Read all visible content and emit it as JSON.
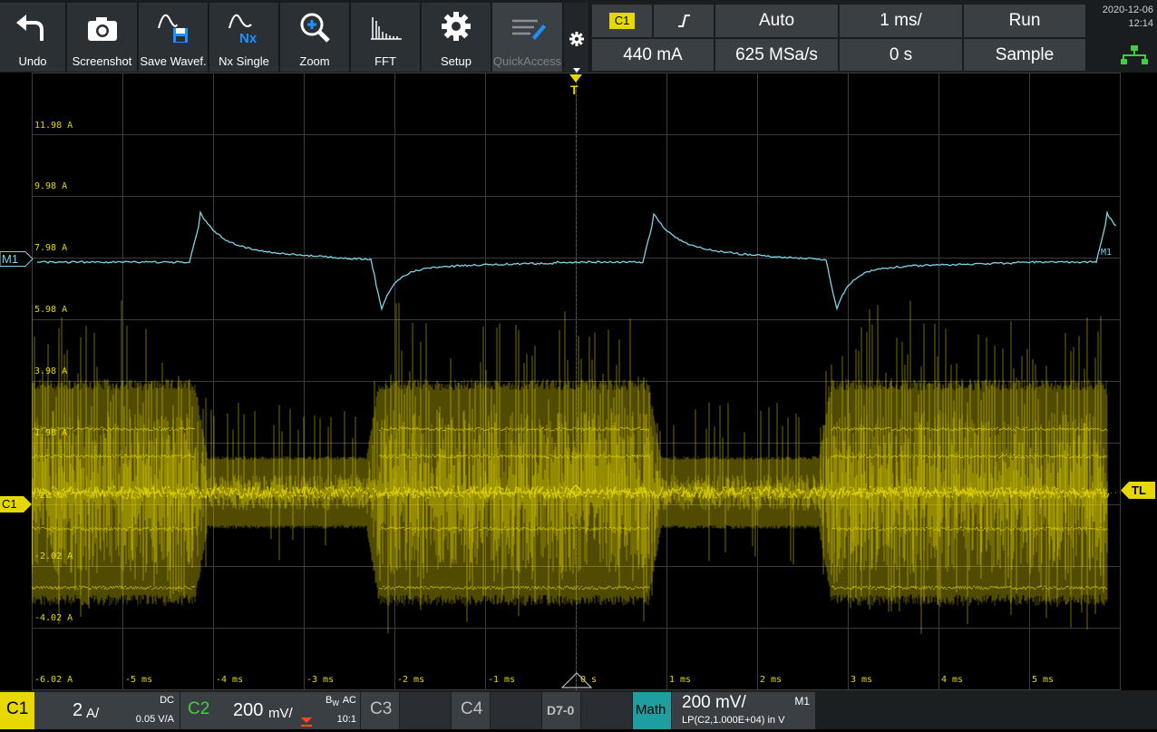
{
  "toolbar": {
    "undo_label": "Undo",
    "screenshot_label": "Screenshot",
    "save_waveform_label": "Save Wavef.",
    "nx_single_label": "Nx Single",
    "nx_icon_text": "Nx",
    "zoom_label": "Zoom",
    "fft_label": "FFT",
    "setup_label": "Setup",
    "quickaccess_label": "QuickAccess"
  },
  "status": {
    "trigger_source": "C1",
    "trigger_mode": "Auto",
    "time_scale": "1 ms/",
    "run_state": "Run",
    "trigger_level": "440 mA",
    "sample_rate": "625 MSa/s",
    "time_offset": "0 s",
    "acquisition_mode": "Sample",
    "date": "2020-12-06",
    "time": "12:14"
  },
  "scope": {
    "m1_marker": "M1",
    "m1_trace_label": "M1",
    "c1_marker": "C1",
    "trigger_marker": "T",
    "trigger_level_marker": "TL",
    "y_labels": [
      "11.98 A",
      "9.98 A",
      "7.98 A",
      "5.98 A",
      "3.98 A",
      "1.98 A",
      "-20 mA",
      "-2.02 A",
      "-4.02 A",
      "-6.02 A"
    ],
    "x_labels": [
      "-5 ms",
      "-4 ms",
      "-3 ms",
      "-2 ms",
      "-1 ms",
      "0 s",
      "1 ms",
      "2 ms",
      "3 ms",
      "4 ms",
      "5 ms"
    ],
    "colors": {
      "c1": "#e6d800",
      "m1": "#7fd3e6",
      "grid": "#3c3c3c"
    }
  },
  "bottom": {
    "c1_label": "C1",
    "c1_scale": "2",
    "c1_unit": "A/",
    "c1_coupling": "DC",
    "c1_ratio": "0.05 V/A",
    "c2_label": "C2",
    "c2_scale": "200",
    "c2_unit": "mV/",
    "c2_bw": "B",
    "c2_bw_sub": "W",
    "c2_coupling": "AC",
    "c2_ratio": "10:1",
    "c3_label": "C3",
    "c4_label": "C4",
    "digital_label": "D7-0",
    "math_label": "Math",
    "math_scale": "200 mV/",
    "math_channel": "M1",
    "math_expr": "LP(C2,1.000E+04) in V"
  }
}
